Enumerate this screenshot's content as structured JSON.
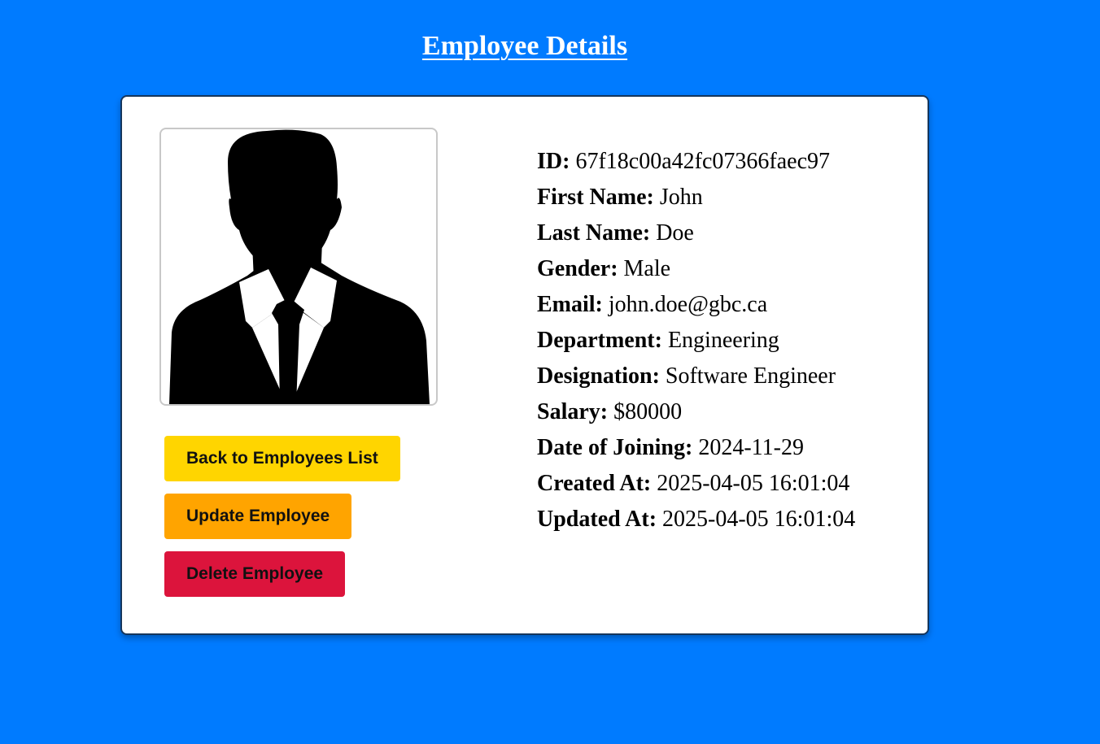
{
  "page": {
    "title": "Employee Details"
  },
  "photo": {
    "icon": "person-silhouette-icon"
  },
  "actions": {
    "back_label": "Back to Employees List",
    "update_label": "Update Employee",
    "delete_label": "Delete Employee"
  },
  "details": [
    {
      "label": "ID:",
      "value": "67f18c00a42fc07366faec97"
    },
    {
      "label": "First Name:",
      "value": "John"
    },
    {
      "label": "Last Name:",
      "value": "Doe"
    },
    {
      "label": "Gender:",
      "value": "Male"
    },
    {
      "label": "Email:",
      "value": "john.doe@gbc.ca"
    },
    {
      "label": "Department:",
      "value": "Engineering"
    },
    {
      "label": "Designation:",
      "value": "Software Engineer"
    },
    {
      "label": "Salary:",
      "value": "$80000"
    },
    {
      "label": "Date of Joining:",
      "value": "2024-11-29"
    },
    {
      "label": "Created At:",
      "value": "2025-04-05 16:01:04"
    },
    {
      "label": "Updated At:",
      "value": "2025-04-05 16:01:04"
    }
  ],
  "colors": {
    "page_background": "#007bff",
    "card_background": "#ffffff",
    "back_button": "#ffd500",
    "update_button": "#ffa400",
    "delete_button": "#dc143c"
  }
}
